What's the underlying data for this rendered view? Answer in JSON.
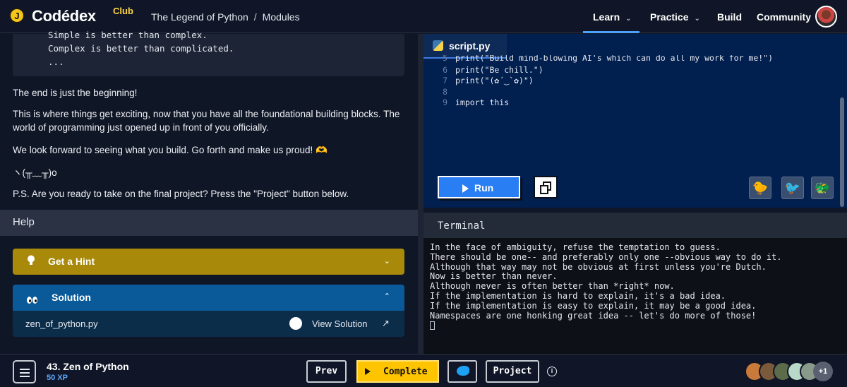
{
  "header": {
    "logo_badge": "J",
    "logo_text": "Codédex",
    "logo_club": "Club",
    "breadcrumb": [
      "The Legend of Python",
      "/",
      "Modules"
    ],
    "nav": [
      {
        "label": "Learn",
        "has_menu": true,
        "active": true
      },
      {
        "label": "Practice",
        "has_menu": true
      },
      {
        "label": "Build"
      },
      {
        "label": "Community"
      }
    ]
  },
  "lesson": {
    "code_lines": [
      "Simple is better than complex.",
      "Complex is better than complicated.",
      "..."
    ],
    "paragraphs": [
      "The end is just the beginning!",
      "This is where things get exciting, now that you have all the foundational building blocks. The world of programming just opened up in front of you officially.",
      "We look forward to seeing what you build. Go forth and make us proud! 🫶",
      "ヽ(╥﹏╥)o",
      "P.S. Are you ready to take on the final project? Press the \"Project\" button below."
    ]
  },
  "help": {
    "title": "Help",
    "hint_label": "Get a Hint",
    "solution_label": "Solution",
    "solution_file": "zen_of_python.py",
    "view_solution": "View Solution",
    "chevron_down": "⌄",
    "chevron_up": "⌃",
    "external": "↗"
  },
  "editor": {
    "tab_name": "script.py",
    "lines": [
      {
        "n": "5",
        "text": "print(\"Build mind-blowing AI's which can do all my work for me!\")"
      },
      {
        "n": "6",
        "text": "print(\"Be chill.\")"
      },
      {
        "n": "7",
        "text": "print(\"(✿´‿`✿)\")"
      },
      {
        "n": "8",
        "text": ""
      },
      {
        "n": "9",
        "text": "import this"
      }
    ],
    "run_label": "Run",
    "pets": [
      "🐤",
      "🐦",
      "🐲"
    ]
  },
  "terminal": {
    "title": "Terminal",
    "output": [
      "In the face of ambiguity, refuse the temptation to guess.",
      "There should be one-- and preferably only one --obvious way to do it.",
      "Although that way may not be obvious at first unless you're Dutch.",
      "Now is better than never.",
      "Although never is often better than *right* now.",
      "If the implementation is hard to explain, it's a bad idea.",
      "If the implementation is easy to explain, it may be a good idea.",
      "Namespaces are one honking great idea -- let's do more of those!"
    ]
  },
  "footer": {
    "lesson_title": "43. Zen of Python",
    "xp": "50 XP",
    "prev": "Prev",
    "complete": "Complete",
    "project": "Project",
    "info": "i",
    "more_count": "+1"
  },
  "colors": {
    "accent_blue": "#2a7ef3",
    "hint_yellow": "#a8890a",
    "solution_blue": "#0a5a99",
    "complete_yellow": "#ffc400",
    "editor_bg": "#011f4f"
  }
}
